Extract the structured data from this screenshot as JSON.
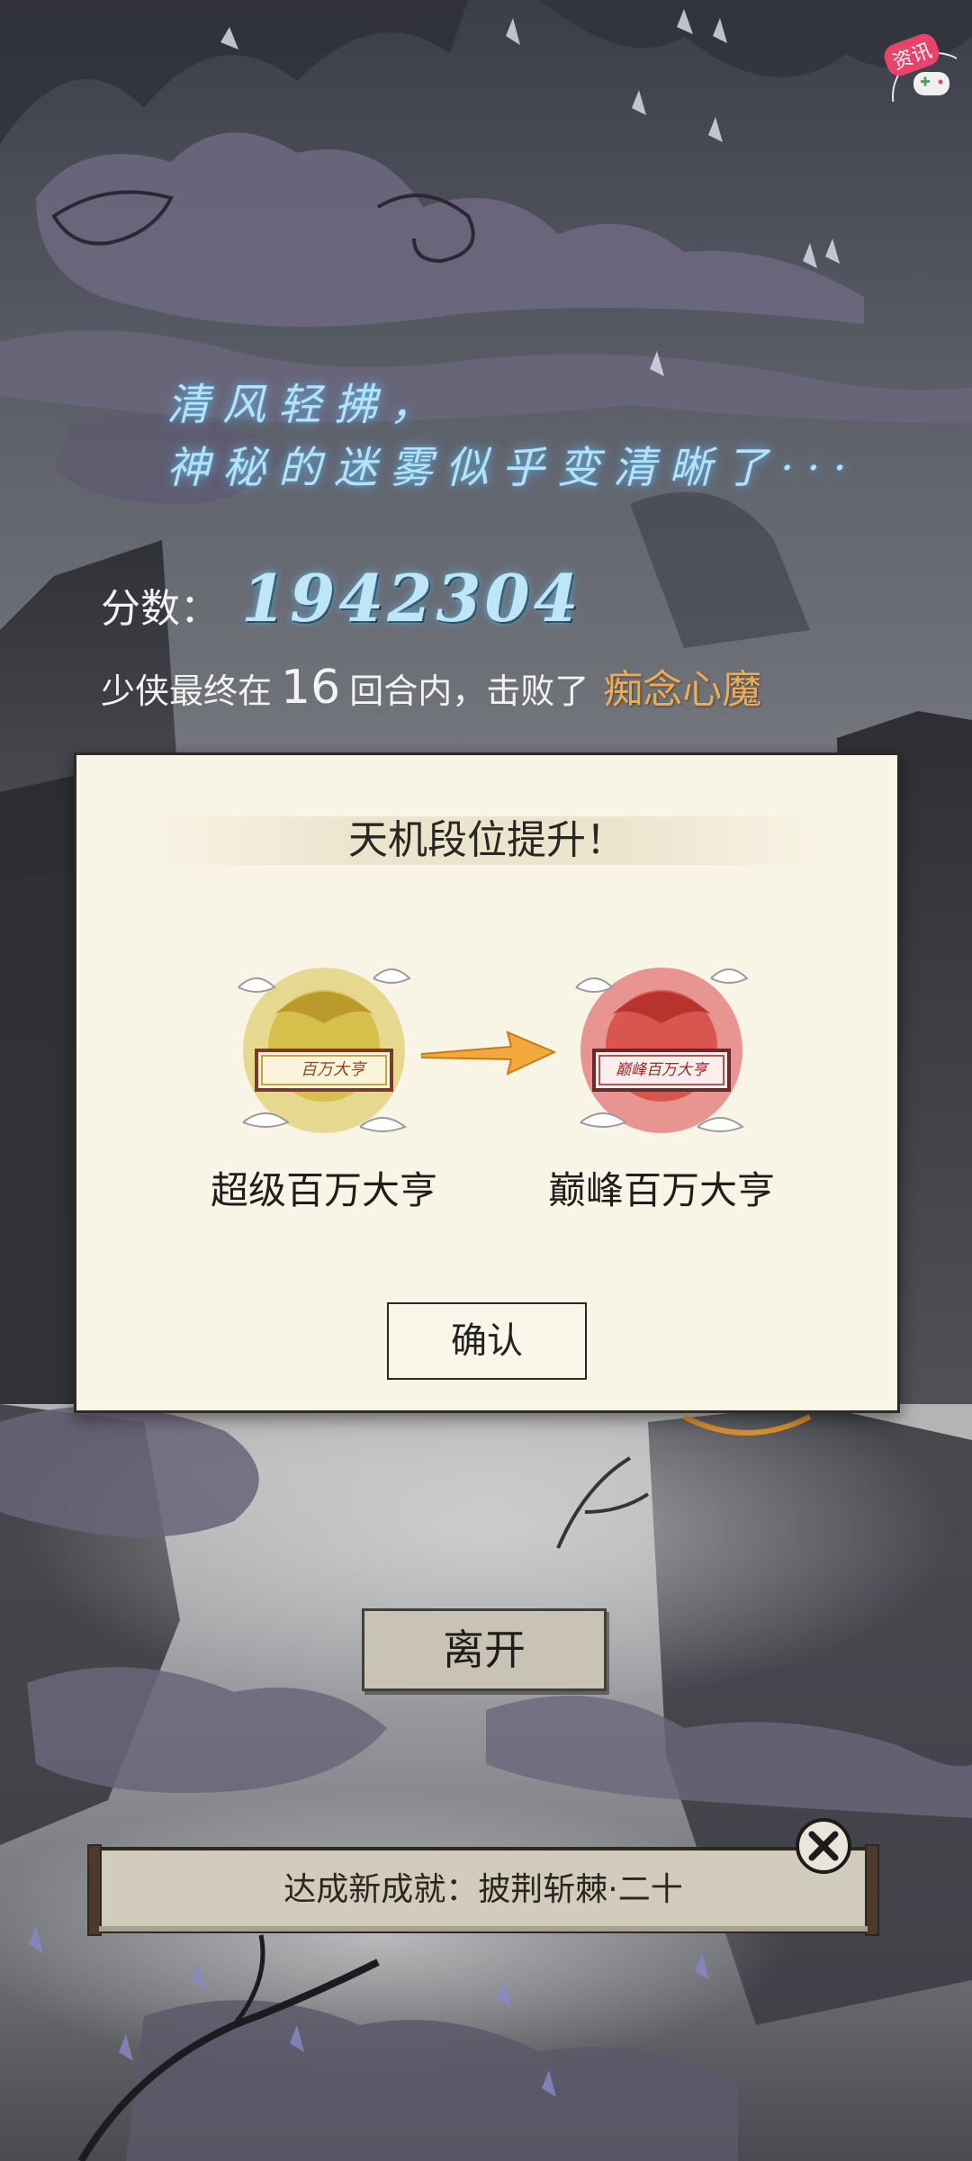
{
  "header": {
    "poem_line_1": "清风轻拂，",
    "poem_line_2": "神秘的迷雾似乎变清晰了···",
    "news_badge": "资讯"
  },
  "result": {
    "score_label": "分数：",
    "score_value": "1942304",
    "line_prefix": "少侠最终在",
    "rounds": "16",
    "line_middle": "回合内，击败了",
    "boss": "痴念心魔"
  },
  "modal": {
    "title": "天机段位提升！",
    "old_rank": {
      "name": "超级百万大亨",
      "plaque_text": "百万大亨",
      "color": "#d8c35a"
    },
    "new_rank": {
      "name": "巅峰百万大亨",
      "plaque_text": "巅峰百万大亨",
      "color": "#d9554f"
    },
    "arrow_color": "#f2a83a",
    "confirm_label": "确认"
  },
  "leave_label": "离开",
  "achievement": {
    "text": "达成新成就：披荆斩棘·二十",
    "close_icon": "close-x-icon"
  }
}
